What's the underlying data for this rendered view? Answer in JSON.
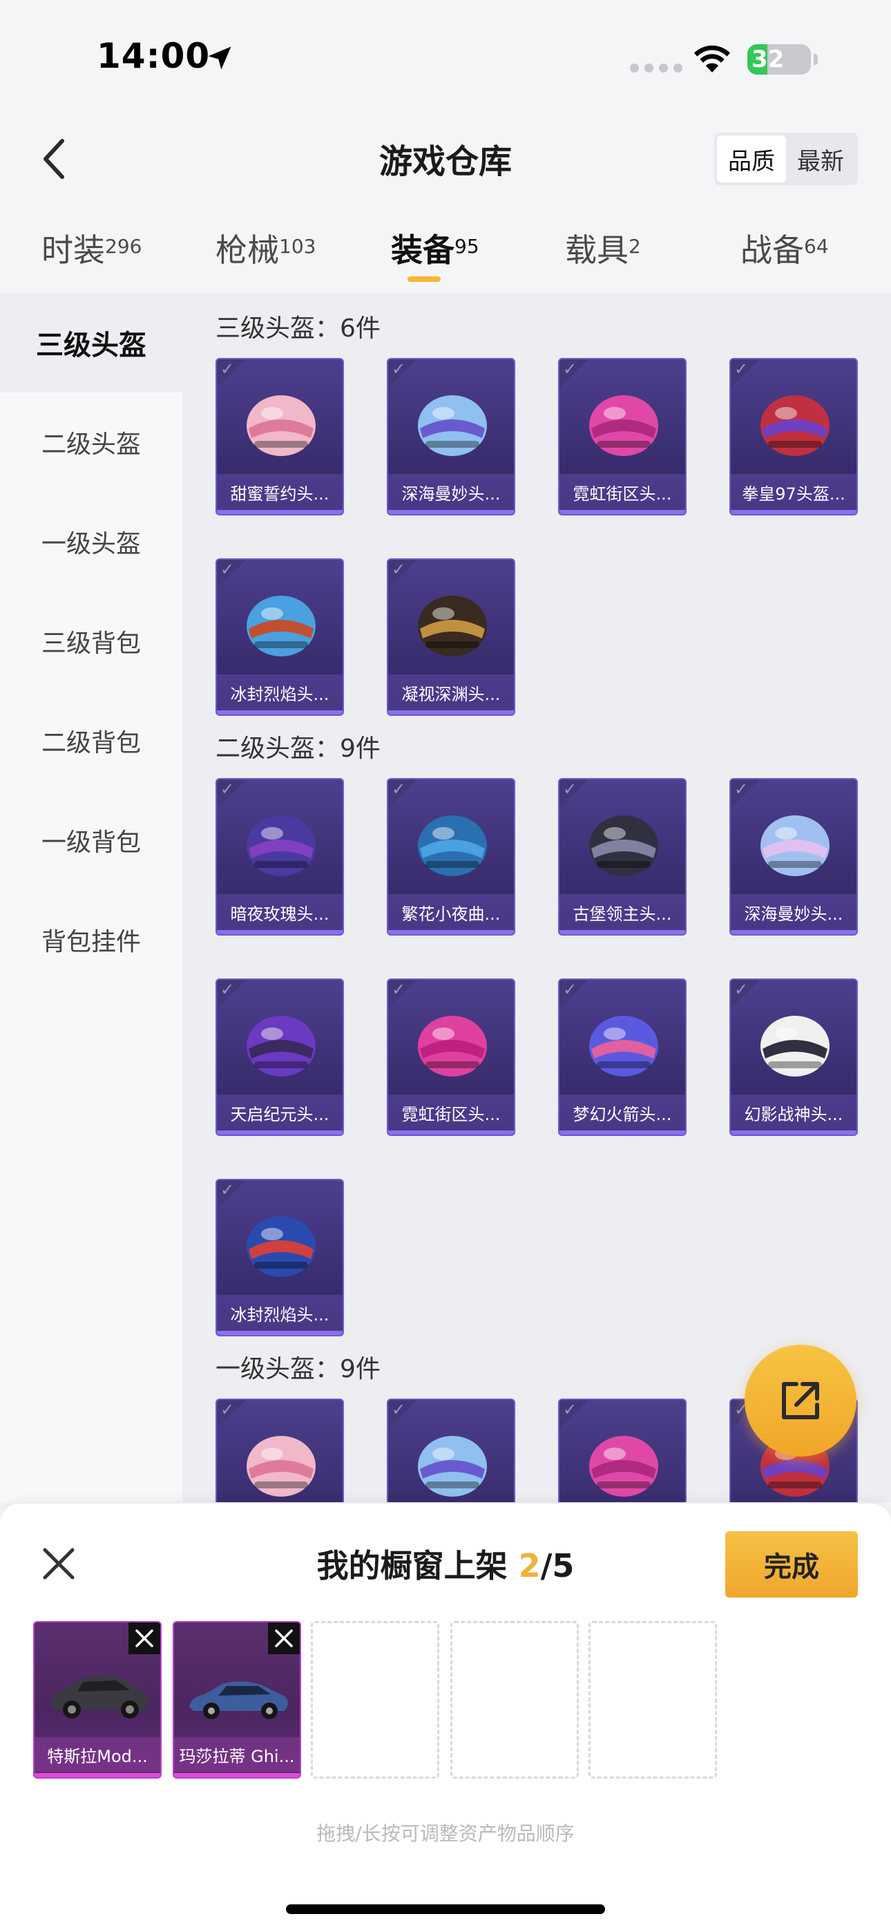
{
  "status": {
    "time": "14:00",
    "battery": "32",
    "battery_level": 0.32
  },
  "header": {
    "title": "游戏仓库",
    "sort": [
      "品质",
      "最新"
    ],
    "active_sort": 0
  },
  "tabs": [
    {
      "label": "时装",
      "count": "296"
    },
    {
      "label": "枪械",
      "count": "103"
    },
    {
      "label": "装备",
      "count": "95",
      "active": true
    },
    {
      "label": "载具",
      "count": "2"
    },
    {
      "label": "战备",
      "count": "64"
    }
  ],
  "side_nav": [
    "三级头盔",
    "二级头盔",
    "一级头盔",
    "三级背包",
    "二级背包",
    "一级背包",
    "背包挂件"
  ],
  "sections": [
    {
      "title": "三级头盔：6件",
      "items": [
        "甜蜜誓约头...",
        "深海曼妙头...",
        "霓虹街区头...",
        "拳皇97头盔...",
        "冰封烈焰头...",
        "凝视深渊头..."
      ]
    },
    {
      "title": "二级头盔：9件",
      "items": [
        "暗夜玫瑰头...",
        "繁花小夜曲...",
        "古堡领主头...",
        "深海曼妙头...",
        "天启纪元头...",
        "霓虹街区头...",
        "梦幻火箭头...",
        "幻影战神头...",
        "冰封烈焰头..."
      ]
    },
    {
      "title": "一级头盔：9件",
      "items": [
        "",
        "",
        "",
        ""
      ]
    }
  ],
  "sheet": {
    "title_prefix": "我的橱窗上架 ",
    "selected": "2",
    "title_suffix": "/5",
    "done": "完成",
    "slots": [
      "特斯拉Mod...",
      "玛莎拉蒂 Ghi..."
    ],
    "hint": "拖拽/长按可调整资产物品顺序"
  },
  "colors": {
    "accent": "#f5b733",
    "card_purple": "#3b2f72",
    "card_pink": "#5b2f6f"
  }
}
